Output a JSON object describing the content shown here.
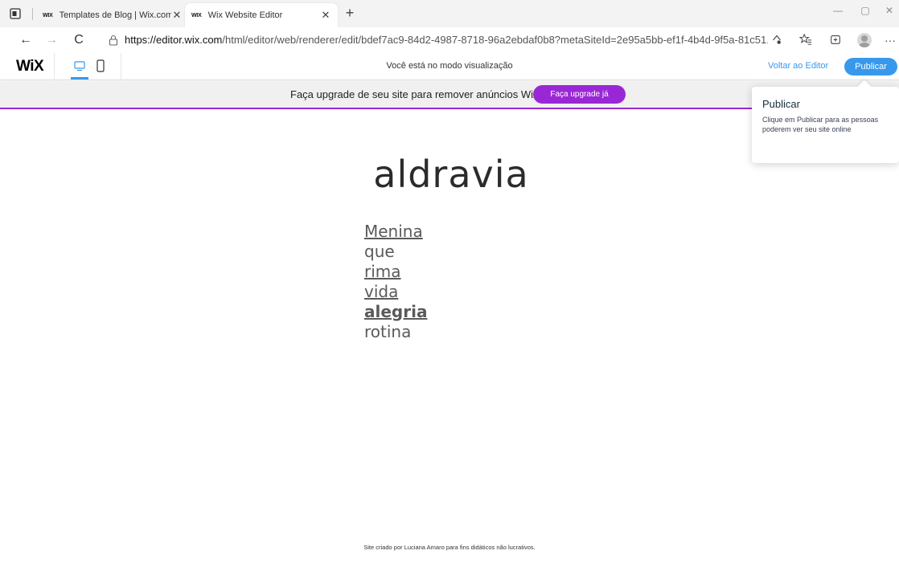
{
  "browser": {
    "tabs": [
      {
        "favicon": "WIX",
        "title": "Templates de Blog | Wix.com",
        "close": "✕"
      },
      {
        "favicon": "WIX",
        "title": "Wix Website Editor",
        "close": "✕"
      }
    ],
    "new_tab": "+",
    "window_controls": {
      "minimize": "—",
      "maximize": "▢",
      "close": "✕"
    },
    "nav": {
      "back": "←",
      "forward": "→",
      "reload": "C"
    },
    "url_host": "https://editor.wix.com",
    "url_path": "/html/editor/web/renderer/edit/bdef7ac9-84d2-4987-8718-96a2ebdaf0b8?metaSiteId=2e95a5bb-ef1f-4b4d-9f5a-81c51...",
    "more": "···"
  },
  "wixbar": {
    "logo": "WiX",
    "preview_text": "Você está no modo visualização",
    "back_to_editor": "Voltar ao Editor",
    "publish": "Publicar"
  },
  "banner": {
    "text": "Faça upgrade de seu site para remover anúncios Wix",
    "button": "Faça upgrade já"
  },
  "tooltip": {
    "title": "Publicar",
    "body": "Clique em Publicar para as pessoas poderem ver seu site online"
  },
  "site": {
    "title": "aldravia",
    "poem": [
      "Menina",
      "que",
      "rima",
      "vida",
      "alegria",
      "rotina"
    ],
    "footer": "Site criado por Luciana Amaro para fins didáticos não lucrativos."
  },
  "colors": {
    "accent_blue": "#3899ec",
    "upgrade_purple": "#9a27d5"
  }
}
